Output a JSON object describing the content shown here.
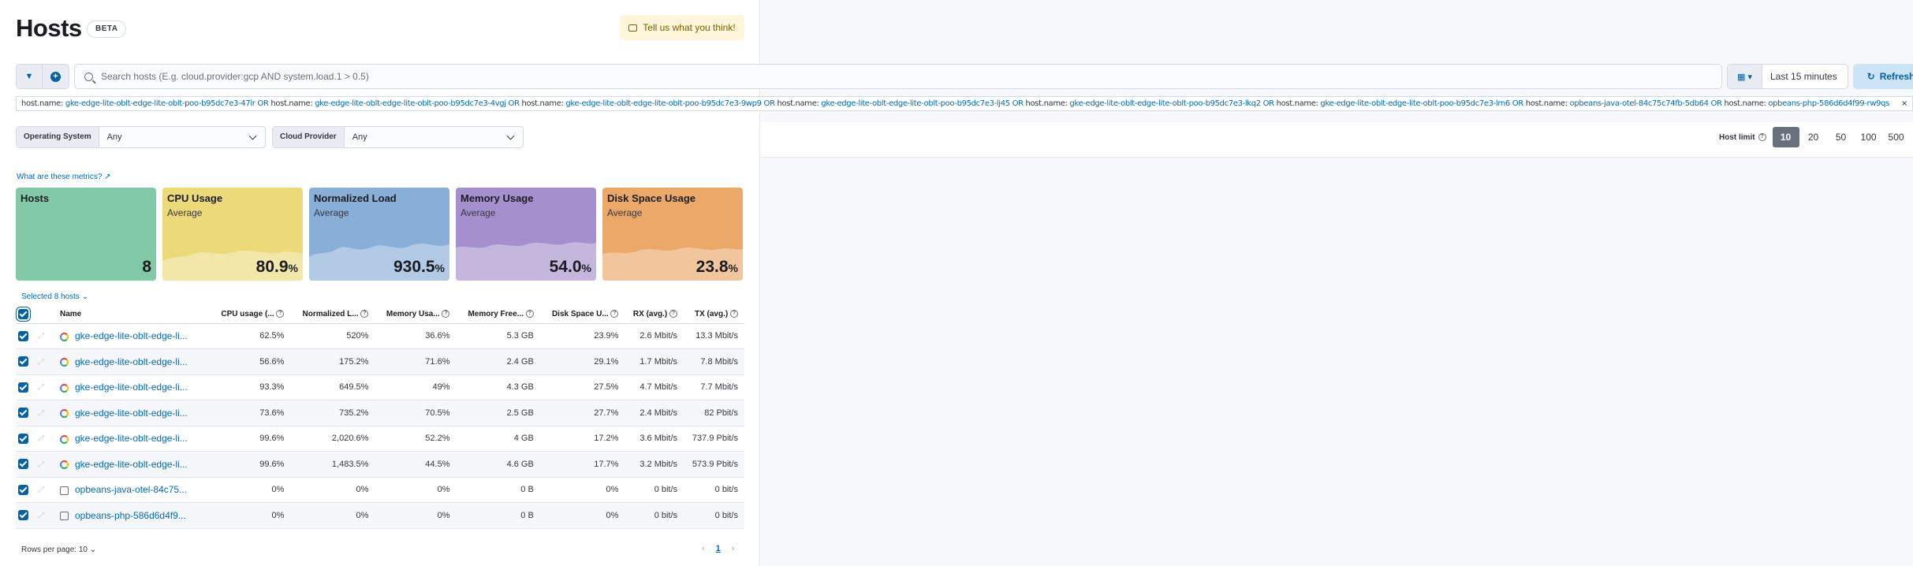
{
  "page": {
    "title": "Hosts",
    "beta": "BETA",
    "feedback": "Tell us what you think!"
  },
  "filter": {
    "search_placeholder": "Search hosts (E.g. cloud.provider:gcp AND system.load.1 > 0.5)",
    "date": "Last 15 minutes",
    "refresh": "Refresh",
    "query_terms": [
      {
        "key": "host.name:",
        "value": "gke-edge-lite-oblt-edge-lite-oblt-poo-b95dc7e3-47lr"
      },
      {
        "key": "host.name:",
        "value": "gke-edge-lite-oblt-edge-lite-oblt-poo-b95dc7e3-4vgj"
      },
      {
        "key": "host.name:",
        "value": "gke-edge-lite-oblt-edge-lite-oblt-poo-b95dc7e3-9wp9"
      },
      {
        "key": "host.name:",
        "value": "gke-edge-lite-oblt-edge-lite-oblt-poo-b95dc7e3-lj45"
      },
      {
        "key": "host.name:",
        "value": "gke-edge-lite-oblt-edge-lite-oblt-poo-b95dc7e3-lkq2"
      },
      {
        "key": "host.name:",
        "value": "gke-edge-lite-oblt-edge-lite-oblt-poo-b95dc7e3-lrn6"
      },
      {
        "key": "host.name:",
        "value": "opbeans-java-otel-84c75c74fb-5db64"
      },
      {
        "key": "host.name:",
        "value": "opbeans-php-586d6d4f99-rw9qs"
      }
    ],
    "or": "OR"
  },
  "controls": {
    "os_label": "Operating System",
    "os_value": "Any",
    "cloud_label": "Cloud Provider",
    "cloud_value": "Any",
    "host_limit_label": "Host limit",
    "host_limits": [
      "10",
      "20",
      "50",
      "100",
      "500"
    ],
    "host_limit_selected": "10"
  },
  "metrics_link": "What are these metrics?",
  "tiles": [
    {
      "title": "Hosts",
      "subtitle": "",
      "value": "8",
      "unit": "",
      "color": "#82c9a8"
    },
    {
      "title": "CPU Usage",
      "subtitle": "Average",
      "value": "80.9",
      "unit": "%",
      "color": "#ecd97a"
    },
    {
      "title": "Normalized Load",
      "subtitle": "Average",
      "value": "930.5",
      "unit": "%",
      "color": "#89aed8"
    },
    {
      "title": "Memory Usage",
      "subtitle": "Average",
      "value": "54.0",
      "unit": "%",
      "color": "#a68fcd"
    },
    {
      "title": "Disk Space Usage",
      "subtitle": "Average",
      "value": "23.8",
      "unit": "%",
      "color": "#eba869"
    }
  ],
  "selection": "Selected 8 hosts",
  "table": {
    "headers": [
      "Name",
      "CPU usage (...",
      "Normalized L...",
      "Memory Usa...",
      "Memory Free...",
      "Disk Space U...",
      "RX (avg.)",
      "TX (avg.)"
    ],
    "rows": [
      {
        "name": "gke-edge-lite-oblt-edge-li...",
        "icon": "gcp",
        "cpu": "62.5%",
        "load": "520%",
        "mem": "36.6%",
        "free": "5.3 GB",
        "disk": "23.9%",
        "rx": "2.6 Mbit/s",
        "tx": "13.3 Mbit/s"
      },
      {
        "name": "gke-edge-lite-oblt-edge-li...",
        "icon": "gcp",
        "cpu": "56.6%",
        "load": "175.2%",
        "mem": "71.6%",
        "free": "2.4 GB",
        "disk": "29.1%",
        "rx": "1.7 Mbit/s",
        "tx": "7.8 Mbit/s"
      },
      {
        "name": "gke-edge-lite-oblt-edge-li...",
        "icon": "gcp",
        "cpu": "93.3%",
        "load": "649.5%",
        "mem": "49%",
        "free": "4.3 GB",
        "disk": "27.5%",
        "rx": "4.7 Mbit/s",
        "tx": "7.7 Mbit/s"
      },
      {
        "name": "gke-edge-lite-oblt-edge-li...",
        "icon": "gcp",
        "cpu": "73.6%",
        "load": "735.2%",
        "mem": "70.5%",
        "free": "2.5 GB",
        "disk": "27.7%",
        "rx": "2.4 Mbit/s",
        "tx": "82 Pbit/s"
      },
      {
        "name": "gke-edge-lite-oblt-edge-li...",
        "icon": "gcp",
        "cpu": "99.6%",
        "load": "2,020.6%",
        "mem": "52.2%",
        "free": "4 GB",
        "disk": "17.2%",
        "rx": "3.6 Mbit/s",
        "tx": "737.9 Pbit/s"
      },
      {
        "name": "gke-edge-lite-oblt-edge-li...",
        "icon": "gcp",
        "cpu": "99.6%",
        "load": "1,483.5%",
        "mem": "44.5%",
        "free": "4.6 GB",
        "disk": "17.7%",
        "rx": "3.2 Mbit/s",
        "tx": "573.9 Pbit/s"
      },
      {
        "name": "opbeans-java-otel-84c75...",
        "icon": "box",
        "cpu": "0%",
        "load": "0%",
        "mem": "0%",
        "free": "0 B",
        "disk": "0%",
        "rx": "0 bit/s",
        "tx": "0 bit/s"
      },
      {
        "name": "opbeans-php-586d6d4f9...",
        "icon": "box",
        "cpu": "0%",
        "load": "0%",
        "mem": "0%",
        "free": "0 B",
        "disk": "0%",
        "rx": "0 bit/s",
        "tx": "0 bit/s"
      }
    ]
  },
  "footer": {
    "rows_per_page": "Rows per page: 10",
    "page": "1"
  }
}
